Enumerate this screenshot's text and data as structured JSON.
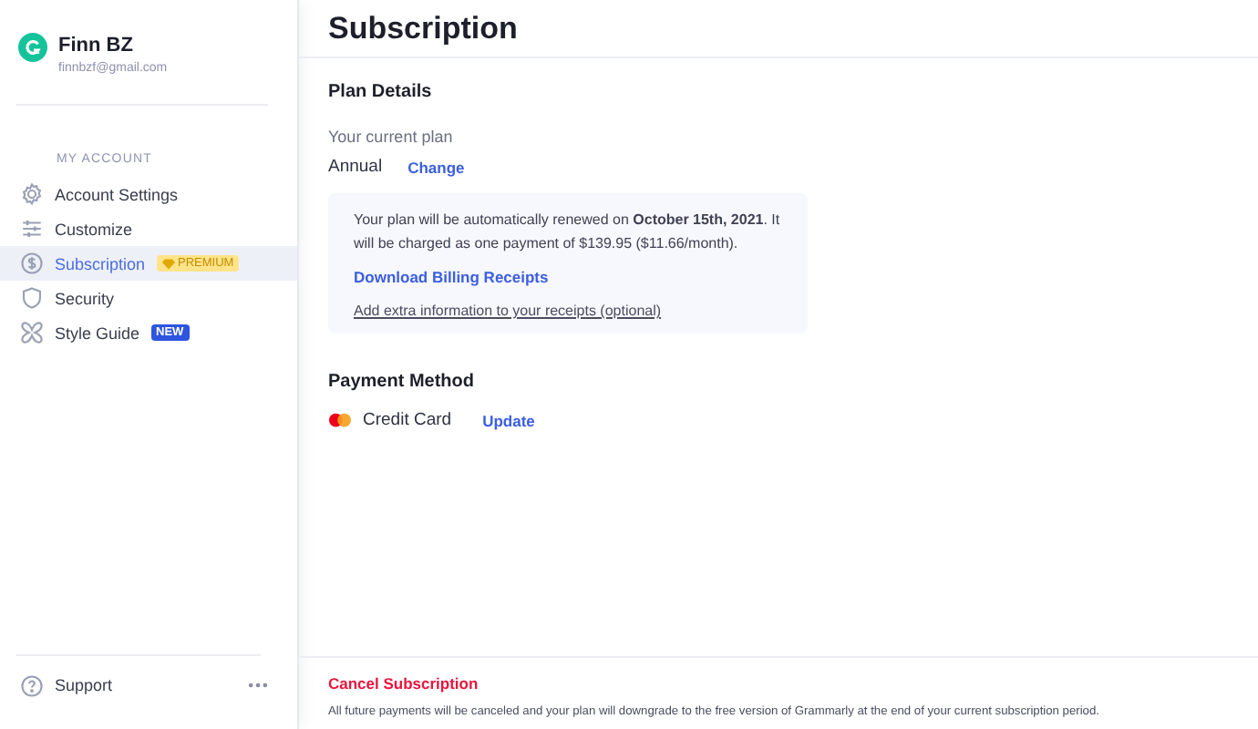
{
  "profile": {
    "name": "Finn BZ",
    "email": "finnbzf@gmail.com"
  },
  "sidebar": {
    "section": "MY ACCOUNT",
    "items": [
      {
        "label": "Account Settings",
        "selected": false
      },
      {
        "label": "Customize",
        "selected": false
      },
      {
        "label": "Subscription",
        "selected": true,
        "badge": {
          "kind": "premium",
          "text": "PREMIUM"
        }
      },
      {
        "label": "Security",
        "selected": false
      },
      {
        "label": "Style Guide",
        "selected": false,
        "badge": {
          "kind": "new",
          "text": "NEW"
        }
      }
    ],
    "footer": {
      "label": "Support"
    }
  },
  "page": {
    "title": "Subscription",
    "plan": {
      "heading": "Plan Details",
      "label": "Your current plan",
      "value": "Annual",
      "action": "Change",
      "notice": "Your plan will be automatically renewed on **October 15th, 2021**. It will be charged as one payment of $139.95 ($11.66/month).",
      "download": "Download Billing Receipts",
      "extra": "Add extra information to your receipts (optional)"
    },
    "payment": {
      "heading": "Payment Method",
      "method": "Credit Card",
      "action": "Update"
    },
    "cancel": {
      "title": "Cancel Subscription",
      "text": "All future payments will be canceled and your plan will downgrade to the free version of Grammarly at the end of your current subscription period."
    }
  }
}
